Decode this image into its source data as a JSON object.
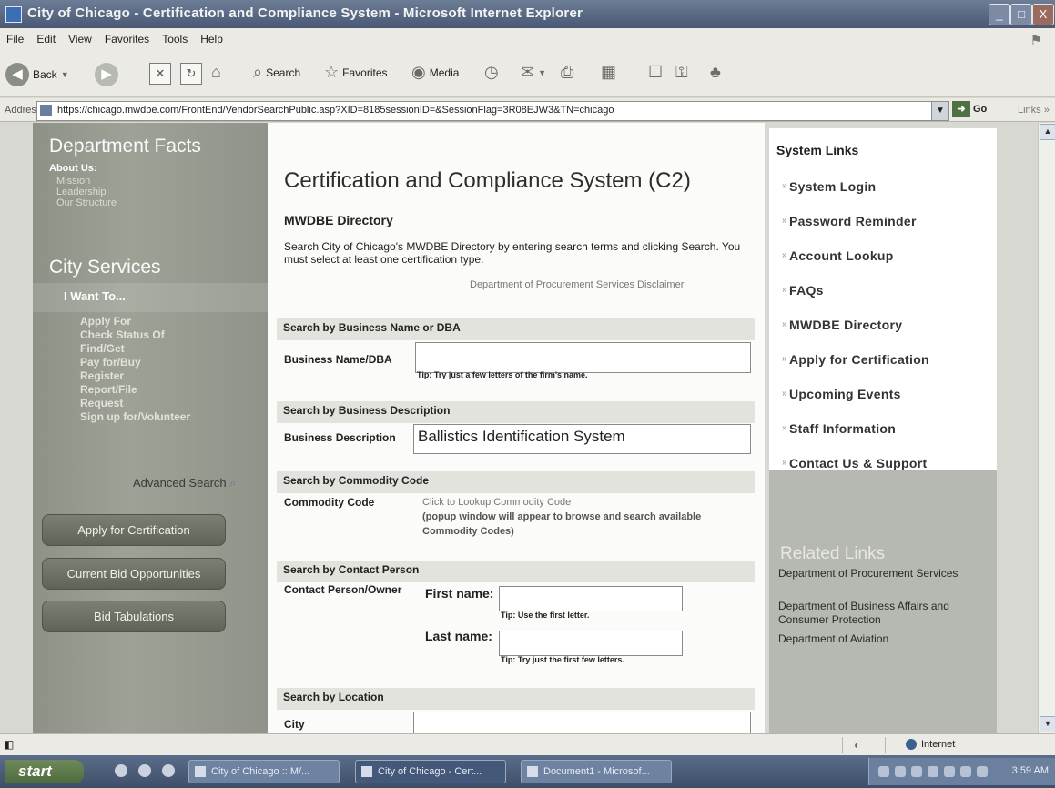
{
  "window": {
    "title": "City of Chicago - Certification and Compliance System - Microsoft Internet Explorer",
    "minimize": "_",
    "maximize": "□",
    "close": "X"
  },
  "menu": [
    "File",
    "Edit",
    "View",
    "Favorites",
    "Tools",
    "Help"
  ],
  "toolbar": {
    "back": "Back",
    "search": "Search",
    "favorites": "Favorites",
    "media": "Media"
  },
  "address": {
    "label": "Address",
    "url": "https://chicago.mwdbe.com/FrontEnd/VendorSearchPublic.asp?XID=8185sessionID=&SessionFlag=3R08EJW3&TN=chicago",
    "go": "Go",
    "links": "Links »"
  },
  "left_nav": {
    "dept_heading": "Department Facts",
    "about": "About Us:",
    "about_items": [
      "Mission",
      "Leadership",
      "Our Structure"
    ],
    "city_heading": "City Services",
    "want": "I Want To...",
    "want_items": [
      "Apply For",
      "Check Status Of",
      "Find/Get",
      "Pay for/Buy",
      "Register",
      "Report/File",
      "Request",
      "Sign up for/Volunteer"
    ],
    "advanced_search": "Advanced Search",
    "buttons": [
      "Apply for Certification",
      "Current Bid Opportunities",
      "Bid Tabulations"
    ]
  },
  "main": {
    "title": "Certification and Compliance System (C2)",
    "subtitle": "MWDBE Directory",
    "intro": "Search City of Chicago's MWDBE Directory by entering search terms and clicking Search. You must select at least one certification type.",
    "disclaimer": "Department of Procurement Services Disclaimer",
    "sec_business_name": "Search by Business Name or DBA",
    "lbl_business_name": "Business Name/DBA",
    "val_business_name": "",
    "tip_business_name": "Tip: Try just a few letters of the firm's name.",
    "sec_business_desc": "Search by Business Description",
    "lbl_business_desc": "Business Description",
    "val_business_desc": "Ballistics Identification System",
    "sec_commodity": "Search by Commodity Code",
    "lbl_commodity": "Commodity Code",
    "commodity_link": "Click to Lookup Commodity Code",
    "commodity_note": "(popup window will appear to browse and search available Commodity Codes)",
    "sec_contact": "Search by Contact Person",
    "lbl_contact": "Contact Person/Owner",
    "lbl_first": "First name:",
    "tip_first": "Tip: Use the first letter.",
    "lbl_last": "Last name:",
    "tip_last": "Tip: Try just the first few letters.",
    "sec_location": "Search by Location",
    "lbl_city": "City"
  },
  "right": {
    "heading": "System Links",
    "links": [
      "System Login",
      "Password Reminder",
      "Account Lookup",
      "FAQs",
      "MWDBE Directory",
      "Apply for Certification",
      "Upcoming Events",
      "Staff Information",
      "Contact Us & Support"
    ],
    "related_heading": "Related Links",
    "related": [
      "Department of Procurement Services",
      "Department of Business Affairs and Consumer Protection",
      "Department of Aviation"
    ]
  },
  "status": {
    "zone": "Internet"
  },
  "taskbar": {
    "start": "start",
    "tasks": [
      "City of Chicago :: M/...",
      "City of Chicago - Cert...",
      "Document1 - Microsof..."
    ],
    "clock": "3:59 AM"
  }
}
